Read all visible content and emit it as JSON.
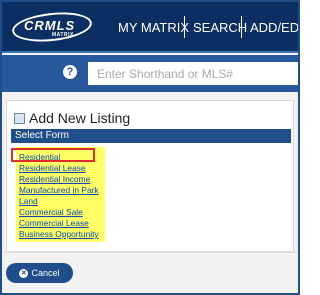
{
  "nav": {
    "logo_text": "CRMLS",
    "logo_sub": "MATRIX",
    "items": [
      "MY MATRIX",
      "SEARCH",
      "ADD/EDIT"
    ]
  },
  "search": {
    "help_symbol": "?",
    "placeholder": "Enter Shorthand or MLS#"
  },
  "card": {
    "title": "Add New Listing",
    "select_form_label": "Select Form",
    "forms": [
      "Residential",
      "Residential Lease",
      "Residential Income",
      "Manufactured in Park",
      "Land",
      "Commercial Sale",
      "Commercial Lease",
      "Business Opportunity"
    ]
  },
  "footer": {
    "cancel_label": "Cancel"
  },
  "colors": {
    "nav_bg": "#0b2f63",
    "search_bg": "#26589b",
    "accent": "#1f4e8a",
    "highlight": "#ffff66",
    "annotation": "#e22b2b"
  }
}
